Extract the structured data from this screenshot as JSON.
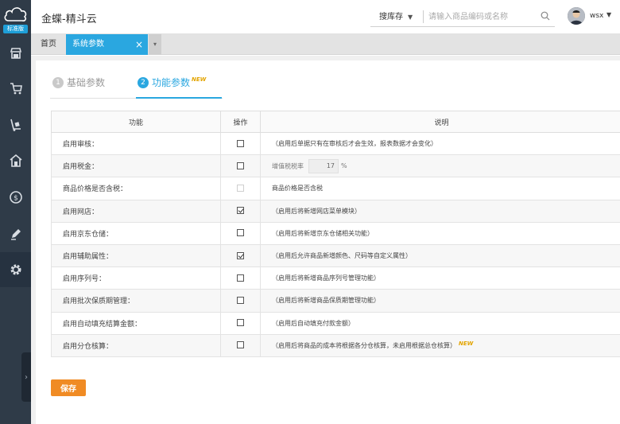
{
  "header": {
    "app_title": "金蝶-精斗云",
    "search_type": "搜库存",
    "search_placeholder": "请输入商品编码或名称",
    "user_name": "wsx"
  },
  "logo": {
    "badge": "标准版"
  },
  "sidebar": {
    "items": [
      {
        "icon": "store-icon"
      },
      {
        "icon": "cart-icon"
      },
      {
        "icon": "trolley-icon"
      },
      {
        "icon": "warehouse-icon"
      },
      {
        "icon": "finance-icon"
      },
      {
        "icon": "pen-icon"
      },
      {
        "icon": "gear-icon"
      }
    ]
  },
  "tabs": {
    "home": "首页",
    "active": "系统参数",
    "close": "×",
    "more": "▾"
  },
  "steps": [
    {
      "num": "1",
      "label": "基础参数"
    },
    {
      "num": "2",
      "label": "功能参数",
      "badge": "NEW"
    }
  ],
  "table": {
    "headers": {
      "func": "功能",
      "op": "操作",
      "desc": "说明"
    },
    "rows": [
      {
        "func": "启用审核：",
        "checked": false,
        "disabled": false,
        "desc": "（启用后单据只有在审核后才会生效，报表数据才会变化）"
      },
      {
        "func": "启用税金：",
        "checked": false,
        "disabled": false,
        "desc": "",
        "tax_label": "增值税税率",
        "tax_value": "17",
        "tax_unit": "%"
      },
      {
        "func": "商品价格是否含税：",
        "checked": false,
        "disabled": true,
        "desc": "商品价格是否含税"
      },
      {
        "func": "启用网店：",
        "checked": true,
        "disabled": false,
        "desc": "（启用后将新增网店菜单模块）"
      },
      {
        "func": "启用京东仓储：",
        "checked": false,
        "disabled": false,
        "desc": "（启用后将新增京东仓储相关功能）"
      },
      {
        "func": "启用辅助属性：",
        "checked": true,
        "disabled": false,
        "desc": "（启用后允许商品新增颜色、尺码等自定义属性）"
      },
      {
        "func": "启用序列号：",
        "checked": false,
        "disabled": false,
        "desc": "（启用后将新增商品序列号管理功能）"
      },
      {
        "func": "启用批次保质期管理：",
        "checked": false,
        "disabled": false,
        "desc": "（启用后将新增商品保质期管理功能）"
      },
      {
        "func": "启用自动填充结算金额：",
        "checked": false,
        "disabled": false,
        "desc": "（启用后自动填充付款金额）"
      },
      {
        "func": "启用分仓核算：",
        "checked": false,
        "disabled": false,
        "desc": "（启用后将商品的成本将根据各分仓核算，未启用根据总仓核算）",
        "badge": "NEW"
      }
    ]
  },
  "save_label": "保存",
  "colors": {
    "accent": "#2aa7e0",
    "save": "#f08b24",
    "sidebar": "#2f3b48"
  }
}
